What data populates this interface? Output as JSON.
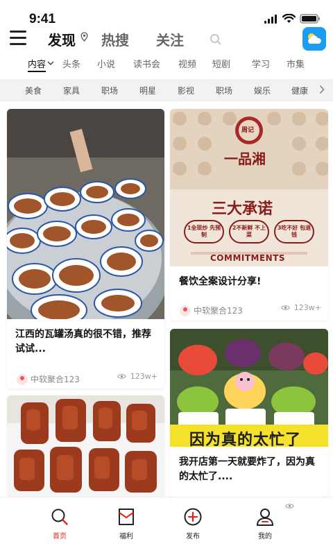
{
  "status_bar": {
    "time": "9:41"
  },
  "header": {
    "tabs": [
      {
        "label": "发现",
        "active": true
      },
      {
        "label": "热搜",
        "active": false
      },
      {
        "label": "关注",
        "active": false
      }
    ]
  },
  "categories": [
    {
      "label": "内容",
      "active": true
    },
    {
      "label": "头条"
    },
    {
      "label": "小说"
    },
    {
      "label": "读书会"
    },
    {
      "label": "视频"
    },
    {
      "label": "短剧"
    },
    {
      "label": "学习"
    },
    {
      "label": "市集"
    }
  ],
  "sub_categories": [
    "美食",
    "家具",
    "职场",
    "明星",
    "影视",
    "职场",
    "娱乐",
    "健康"
  ],
  "feed": {
    "card1": {
      "title": "江西的瓦罐汤真的很不错，推荐试试...",
      "author": "中软聚合123",
      "views": "123w+"
    },
    "card2": {
      "title": "餐饮全案设计分享!",
      "author": "中软聚合123",
      "views": "123w+",
      "image_text": {
        "brand_seal": "周记",
        "brand_name": "一品湘",
        "promise_title": "三大承诺",
        "promise_1": "1全现炒 先预制",
        "promise_2": "2不新鲜 不上菜",
        "promise_3": "3吃不好 包退钱",
        "commitments": "COMMITMENTS"
      }
    },
    "card3": {},
    "card4": {
      "title": "我开店第一天就要炸了，因为真的太忙了....",
      "image_caption": "因为真的太忙了"
    }
  },
  "bottom_nav": [
    {
      "label": "首页",
      "icon": "search-icon",
      "active": true
    },
    {
      "label": "福利",
      "icon": "gift-envelope-icon"
    },
    {
      "label": "发布",
      "icon": "add-circle-icon"
    },
    {
      "label": "我的",
      "icon": "person-icon"
    }
  ],
  "colors": {
    "accent_red": "#e1251b",
    "weather_blue": "#1a9cf0",
    "sub_bar_bg": "#f2f2f2"
  }
}
